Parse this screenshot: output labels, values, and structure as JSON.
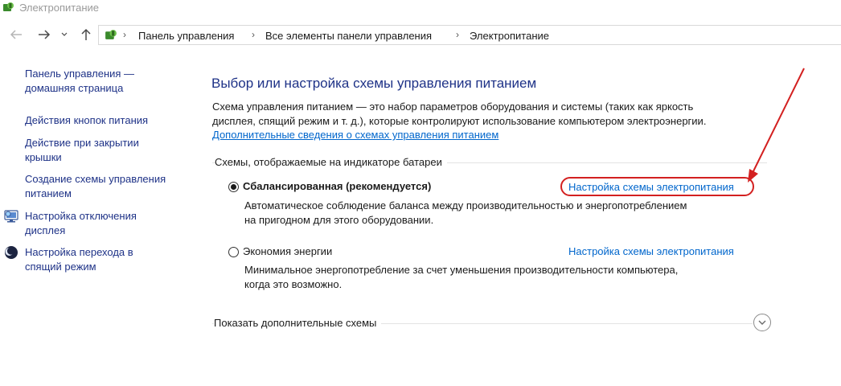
{
  "window": {
    "title": "Электропитание"
  },
  "address_bar": {
    "crumbs": [
      "Панель управления",
      "Все элементы панели управления",
      "Электропитание"
    ]
  },
  "sidebar": {
    "items": [
      {
        "line1": "Панель управления —",
        "line2": "домашняя страница"
      },
      {
        "line1": "Действия кнопок питания"
      },
      {
        "line1": "Действие при закрытии",
        "line2": "крышки"
      },
      {
        "line1": "Создание схемы управления",
        "line2": "питанием"
      },
      {
        "line1": "Настройка отключения",
        "line2": "дисплея",
        "icon": "display-off-icon"
      },
      {
        "line1": "Настройка перехода в",
        "line2": "спящий режим",
        "icon": "sleep-moon-icon"
      }
    ]
  },
  "main": {
    "title": "Выбор или настройка схемы управления питанием",
    "description_line1": "Схема управления питанием — это набор параметров оборудования и системы (таких как яркость",
    "description_line2": "дисплея, спящий режим и т. д.), которые контролируют использование компьютером электроэнергии.",
    "more_info_link": "Дополнительные сведения о схемах управления питанием",
    "group_label": "Схемы, отображаемые на индикаторе батареи",
    "plans": [
      {
        "name": "Сбалансированная (рекомендуется)",
        "selected": true,
        "desc_line1": "Автоматическое соблюдение баланса между производительностью и энергопотреблением",
        "desc_line2": "на пригодном для этого оборудовании.",
        "link": "Настройка схемы электропитания"
      },
      {
        "name": "Экономия энергии",
        "selected": false,
        "desc_line1": "Минимальное энергопотребление за счет уменьшения производительности компьютера,",
        "desc_line2": "когда это возможно.",
        "link": "Настройка схемы электропитания"
      }
    ],
    "show_more_label": "Показать дополнительные схемы"
  },
  "annotation": {
    "color": "#d32020"
  },
  "colors": {
    "link": "#0066cc",
    "heading": "#1e3287"
  }
}
